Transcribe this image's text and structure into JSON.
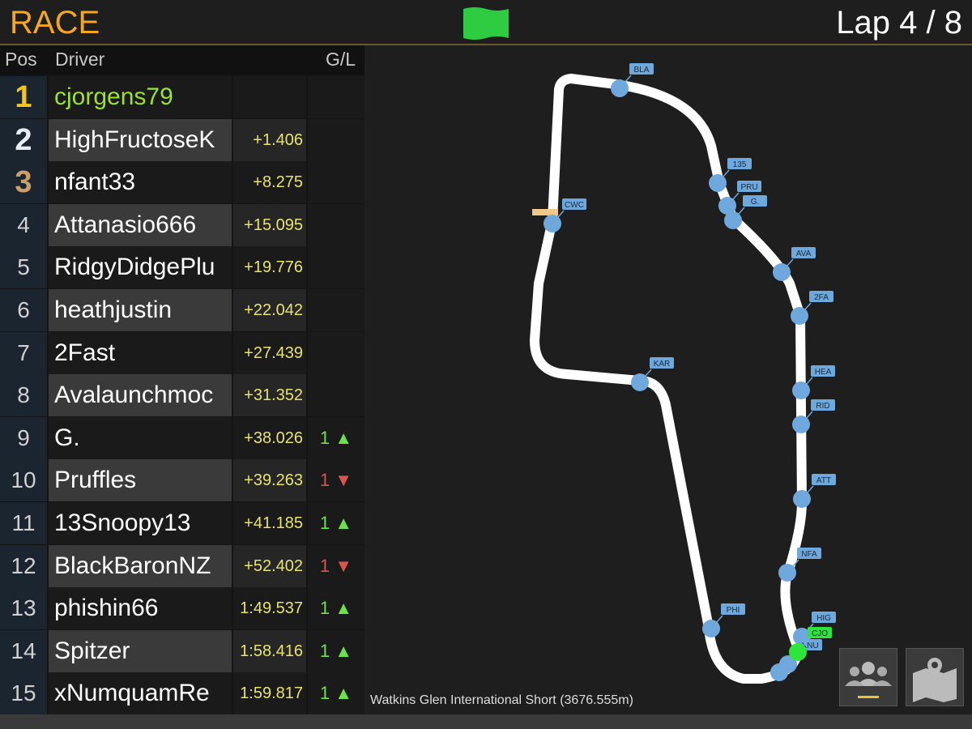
{
  "header": {
    "title": "RACE",
    "lap_label": "Lap",
    "lap_current": "4",
    "lap_separator": "/",
    "lap_total": "8",
    "flag_color": "#2ecc40"
  },
  "leaderboard": {
    "columns": {
      "pos": "Pos",
      "driver": "Driver",
      "gl": "G/L"
    },
    "rows": [
      {
        "pos": "1",
        "driver": "cjorgens79",
        "gap": "",
        "gl": "",
        "dir": ""
      },
      {
        "pos": "2",
        "driver": "HighFructoseK",
        "gap": "+1.406",
        "gl": "",
        "dir": ""
      },
      {
        "pos": "3",
        "driver": "nfant33",
        "gap": "+8.275",
        "gl": "",
        "dir": ""
      },
      {
        "pos": "4",
        "driver": "Attanasio666",
        "gap": "+15.095",
        "gl": "",
        "dir": ""
      },
      {
        "pos": "5",
        "driver": "RidgyDidgePlu",
        "gap": "+19.776",
        "gl": "",
        "dir": ""
      },
      {
        "pos": "6",
        "driver": "heathjustin",
        "gap": "+22.042",
        "gl": "",
        "dir": ""
      },
      {
        "pos": "7",
        "driver": "2Fast",
        "gap": "+27.439",
        "gl": "",
        "dir": ""
      },
      {
        "pos": "8",
        "driver": "Avalaunchmoc",
        "gap": "+31.352",
        "gl": "",
        "dir": ""
      },
      {
        "pos": "9",
        "driver": "G.",
        "gap": "+38.026",
        "gl": "1",
        "dir": "up"
      },
      {
        "pos": "10",
        "driver": "Pruffles",
        "gap": "+39.263",
        "gl": "1",
        "dir": "down"
      },
      {
        "pos": "11",
        "driver": "13Snoopy13",
        "gap": "+41.185",
        "gl": "1",
        "dir": "up"
      },
      {
        "pos": "12",
        "driver": "BlackBaronNZ",
        "gap": "+52.402",
        "gl": "1",
        "dir": "down"
      },
      {
        "pos": "13",
        "driver": "phishin66",
        "gap": "1:49.537",
        "gl": "1",
        "dir": "up"
      },
      {
        "pos": "14",
        "driver": "Spitzer",
        "gap": "1:58.416",
        "gl": "1",
        "dir": "up"
      },
      {
        "pos": "15",
        "driver": "xNumquamRe",
        "gap": "1:59.817",
        "gl": "1",
        "dir": "up"
      }
    ],
    "colors": {
      "p1": "#f5c518",
      "p2": "#e8eef5",
      "p3": "#c9a06a",
      "leader_name": "#9be22d",
      "gap": "#e8e36a",
      "gain": "#6be24a",
      "loss": "#d9534f"
    }
  },
  "track": {
    "name": "Watkins Glen International Short (3676.555m)",
    "markers": [
      "BLA",
      "135",
      "PRU",
      "G.",
      "AVA",
      "2FA",
      "HEA",
      "RID",
      "ATT",
      "NFA",
      "HIG",
      "CJO",
      "XNU",
      "PHI",
      "KAR",
      "CWC"
    ],
    "leader_marker": "CJO",
    "marker_color": "#6fa8dc",
    "leader_color": "#2ee63a",
    "track_color": "#ffffff",
    "start_line_color": "#f0c88a"
  },
  "buttons": {
    "drivers": "people-icon",
    "map": "map-icon"
  }
}
